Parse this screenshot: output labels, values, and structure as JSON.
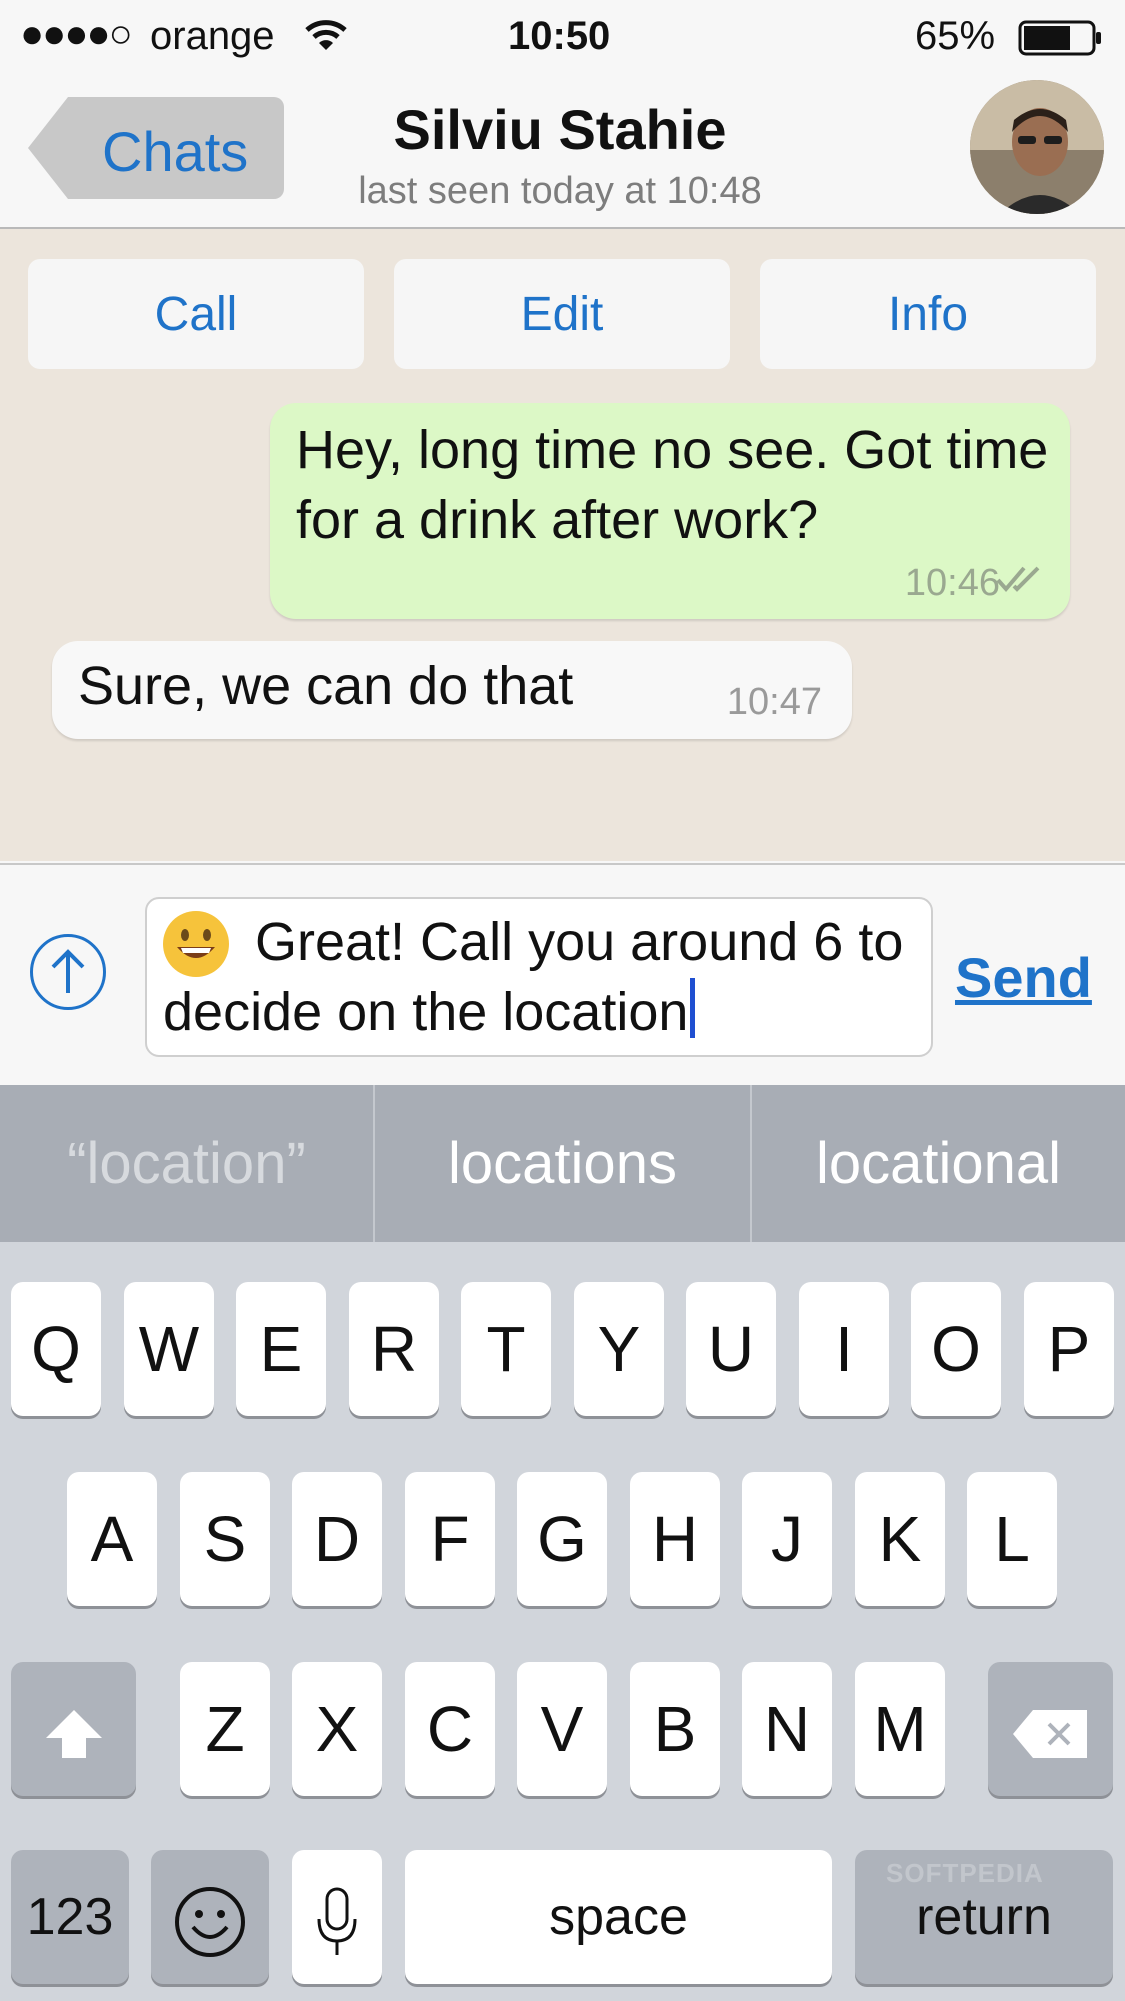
{
  "status_bar": {
    "signal": "●●●●○",
    "carrier": "orange",
    "time": "10:50",
    "battery": "65%"
  },
  "nav": {
    "back_label": "Chats",
    "contact_name": "Silviu Stahie",
    "last_seen": "last seen today at 10:48"
  },
  "actions": {
    "call": "Call",
    "edit": "Edit",
    "info": "Info"
  },
  "messages": [
    {
      "text": "Hey, long time no see. Got time for a drink after work?",
      "time": "10:46"
    },
    {
      "text": "Sure, we can do that",
      "time": "10:47"
    }
  ],
  "composer": {
    "text": "Great! Call you around 6 to decide on the location",
    "send_label": "Send"
  },
  "suggestions": [
    "“location”",
    "locations",
    "locational"
  ],
  "keyboard": {
    "row1": [
      "Q",
      "W",
      "E",
      "R",
      "T",
      "Y",
      "U",
      "I",
      "O",
      "P"
    ],
    "row2": [
      "A",
      "S",
      "D",
      "F",
      "G",
      "H",
      "J",
      "K",
      "L"
    ],
    "row3": [
      "Z",
      "X",
      "C",
      "V",
      "B",
      "N",
      "M"
    ],
    "numbers": "123",
    "space": "space",
    "return": "return"
  },
  "watermark": "SOFTPEDIA",
  "icons": {
    "wifi": "wifi-icon",
    "battery": "battery-icon",
    "attach": "arrow-up-circle-icon",
    "shift": "shift-icon",
    "delete": "backspace-icon",
    "emoji": "emoji-icon",
    "mic": "microphone-icon",
    "read": "double-check-icon"
  },
  "colors": {
    "accent": "#1f73c9",
    "outgoing_bubble": "#dcf8c6",
    "chat_background": "#ece5dc"
  }
}
